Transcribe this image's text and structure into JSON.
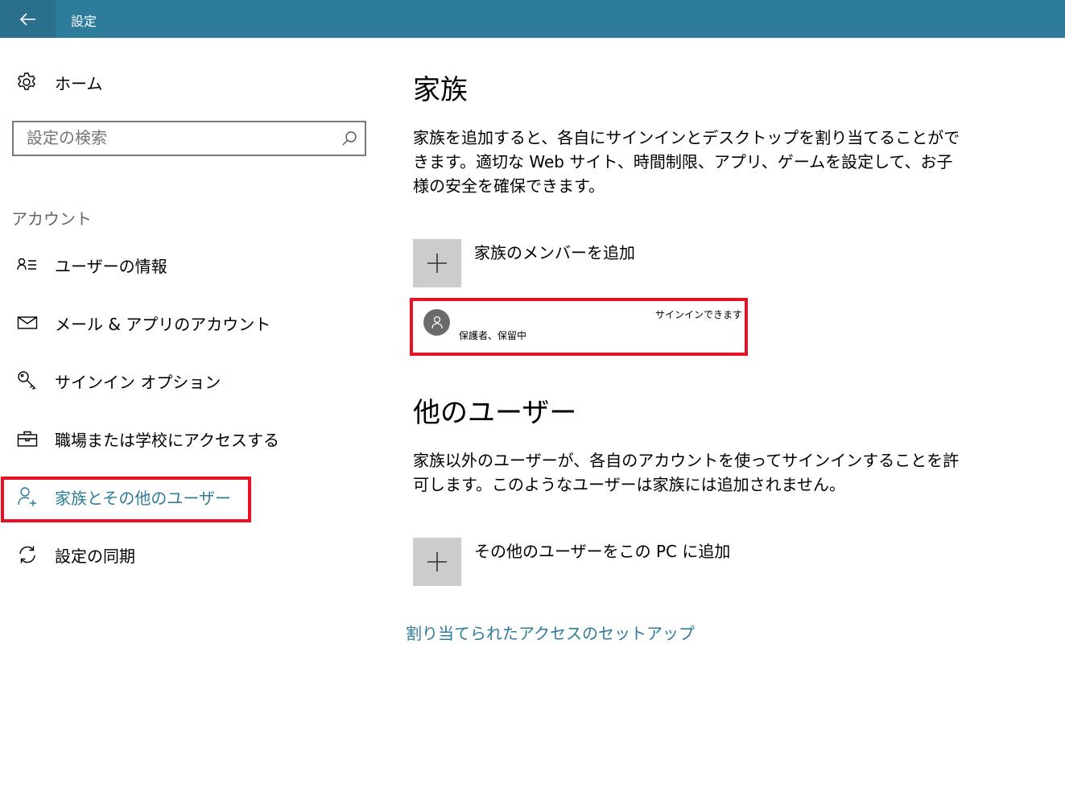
{
  "window": {
    "title": "設定"
  },
  "sidebar": {
    "home_label": "ホーム",
    "search_placeholder": "設定の検索",
    "section_label": "アカウント",
    "items": [
      {
        "label": "ユーザーの情報",
        "icon": "user-info-icon"
      },
      {
        "label": "メール & アプリのアカウント",
        "icon": "mail-icon"
      },
      {
        "label": "サインイン オプション",
        "icon": "key-icon"
      },
      {
        "label": "職場または学校にアクセスする",
        "icon": "briefcase-icon"
      },
      {
        "label": "家族とその他のユーザー",
        "icon": "add-person-icon",
        "active": true
      },
      {
        "label": "設定の同期",
        "icon": "sync-icon"
      }
    ]
  },
  "main": {
    "family": {
      "heading": "家族",
      "description": "家族を追加すると、各自にサインインとデスクトップを割り当てることができます。適切な Web サイト、時間制限、アプリ、ゲームを設定して、お子様の安全を確保できます。",
      "add_label": "家族のメンバーを追加",
      "member": {
        "status": "サインインできます",
        "role": "保護者、保留中"
      }
    },
    "others": {
      "heading": "他のユーザー",
      "description": "家族以外のユーザーが、各自のアカウントを使ってサインインすることを許可します。このようなユーザーは家族には追加されません。",
      "add_label": "その他のユーザーをこの PC に追加"
    },
    "assigned_access_link": "割り当てられたアクセスのセットアップ"
  },
  "colors": {
    "accent": "#2e7c9b",
    "highlight": "#e81123",
    "tile": "#cccccc"
  }
}
